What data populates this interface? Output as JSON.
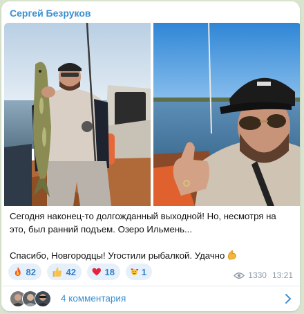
{
  "post": {
    "author": "Сергей Безруков",
    "text_lines": [
      "Сегодня наконец-то долгожданный выходной! Но, несмотря на",
      "это, был ранний подъем. Озеро Ильмень..."
    ],
    "text_line3": "Спасибо, Новгородцы! Угостили рыбалкой. Удачно",
    "text_emoji": "flexed-biceps-emoji",
    "photos": [
      {
        "name": "photo-fishing-boat",
        "description_icon": "photo"
      },
      {
        "name": "photo-selfie-lake",
        "description_icon": "photo"
      }
    ]
  },
  "reactions": [
    {
      "emoji": "fire-emoji",
      "count": "82"
    },
    {
      "emoji": "thumbs-up-emoji",
      "count": "42"
    },
    {
      "emoji": "red-heart-emoji",
      "count": "18"
    },
    {
      "emoji": "smiling-face-with-hearts-emoji",
      "count": "1"
    }
  ],
  "meta": {
    "views": "1330",
    "time": "13:21",
    "views_icon": "eye-icon"
  },
  "comments": {
    "label": "4 комментария",
    "chevron_icon": "chevron-right-icon"
  },
  "colors": {
    "accent": "#3a8fd1",
    "background": "#d9e4cf",
    "reaction_bg": "#e6f0fb"
  }
}
